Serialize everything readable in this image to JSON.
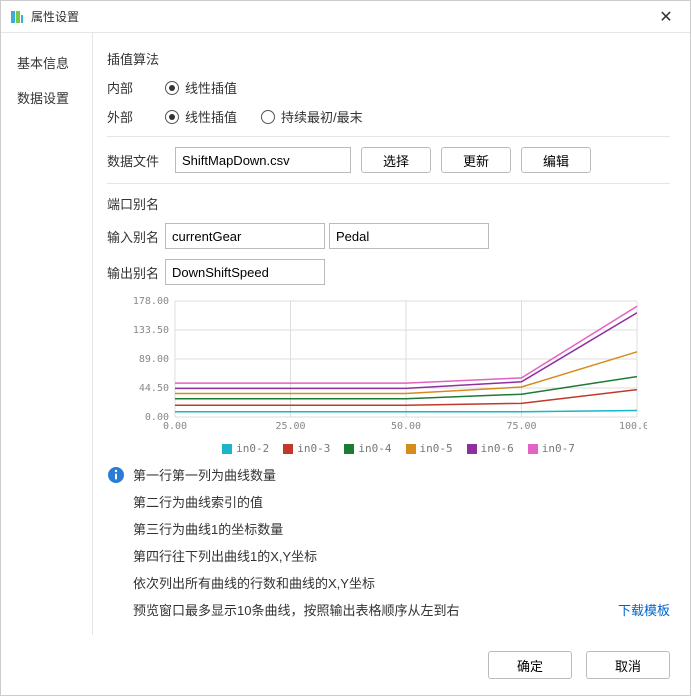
{
  "titlebar": {
    "title": "属性设置"
  },
  "sidebar": {
    "tabs": [
      {
        "label": "基本信息"
      },
      {
        "label": "数据设置"
      }
    ]
  },
  "content": {
    "algo_label": "插值算法",
    "inner_label": "内部",
    "outer_label": "外部",
    "interp_linear": "线性插值",
    "interp_hold": "持续最初/最末",
    "data_file_label": "数据文件",
    "data_file_value": "ShiftMapDown.csv",
    "btn_select": "选择",
    "btn_update": "更新",
    "btn_edit": "编辑",
    "port_alias_label": "端口别名",
    "input_alias_label": "输入别名",
    "input_alias_1": "currentGear",
    "input_alias_2": "Pedal",
    "output_alias_label": "输出别名",
    "output_alias_1": "DownShiftSpeed",
    "info": [
      "第一行第一列为曲线数量",
      "第二行为曲线索引的值",
      "第三行为曲线1的坐标数量",
      "第四行往下列出曲线1的X,Y坐标",
      "依次列出所有曲线的行数和曲线的X,Y坐标",
      "预览窗口最多显示10条曲线，按照输出表格顺序从左到右"
    ],
    "download_template": "下载模板"
  },
  "footer": {
    "ok": "确定",
    "cancel": "取消"
  },
  "chart_data": {
    "type": "line",
    "xlabel": "",
    "ylabel": "",
    "xlim": [
      0,
      100
    ],
    "ylim": [
      0,
      178
    ],
    "x_ticks": [
      0.0,
      25.0,
      50.0,
      75.0,
      100.0
    ],
    "y_ticks": [
      0.0,
      44.5,
      89.0,
      133.5,
      178.0
    ],
    "x": [
      0,
      25,
      50,
      75,
      100
    ],
    "series": [
      {
        "name": "in0-2",
        "color": "#18b6c6",
        "values": [
          8,
          8,
          8,
          8,
          10
        ]
      },
      {
        "name": "in0-3",
        "color": "#c0392b",
        "values": [
          18,
          18,
          18,
          21,
          42
        ]
      },
      {
        "name": "in0-4",
        "color": "#1e7b34",
        "values": [
          28,
          28,
          28,
          35,
          62
        ]
      },
      {
        "name": "in0-5",
        "color": "#d68b1e",
        "values": [
          36,
          36,
          36,
          46,
          100
        ]
      },
      {
        "name": "in0-6",
        "color": "#8e2fa0",
        "values": [
          44,
          44,
          44,
          54,
          160
        ]
      },
      {
        "name": "in0-7",
        "color": "#e362c3",
        "values": [
          52,
          52,
          52,
          60,
          170
        ]
      }
    ]
  }
}
